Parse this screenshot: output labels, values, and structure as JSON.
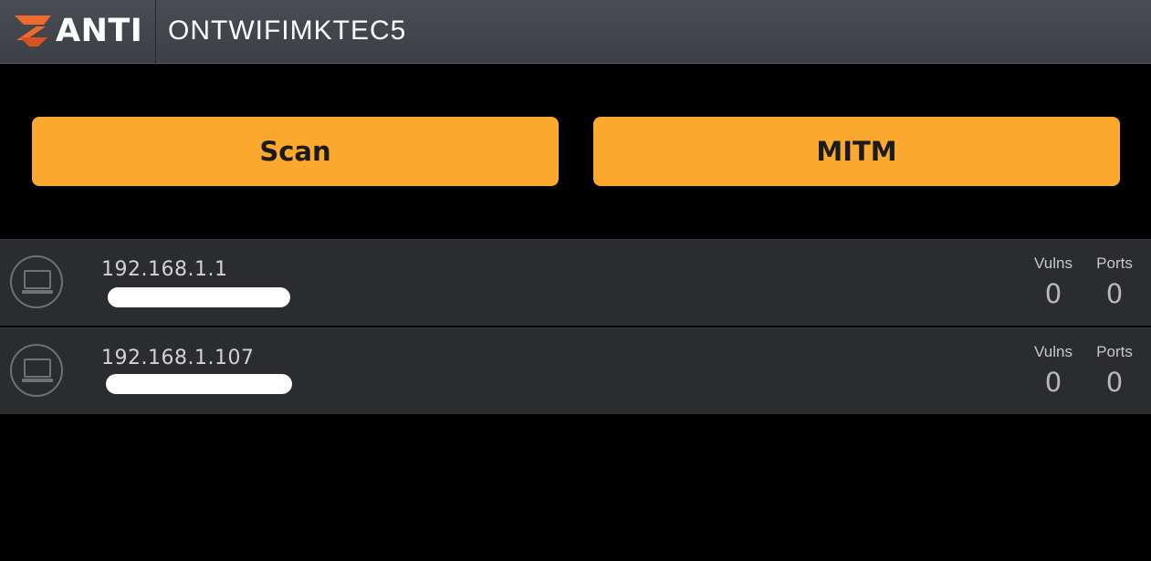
{
  "header": {
    "logo_text": "ANTI",
    "network_name": "ONTWIFIMKTEC5",
    "logo_icon": "anti-logo-icon"
  },
  "actions": {
    "scan_label": "Scan",
    "mitm_label": "MITM"
  },
  "devices": [
    {
      "ip": "192.168.1.1",
      "subtitle": "",
      "icon": "laptop-icon",
      "vulns_label": "Vulns",
      "vulns": "0",
      "ports_label": "Ports",
      "ports": "0"
    },
    {
      "ip": "192.168.1.107",
      "subtitle": "",
      "icon": "laptop-icon",
      "vulns_label": "Vulns",
      "vulns": "0",
      "ports_label": "Ports",
      "ports": "0"
    }
  ],
  "colors": {
    "accent": "#fba82f",
    "logo_orange": "#f16a2d",
    "header_bg": "#44474d",
    "row_bg": "#2b2c2f",
    "background": "#000000"
  }
}
